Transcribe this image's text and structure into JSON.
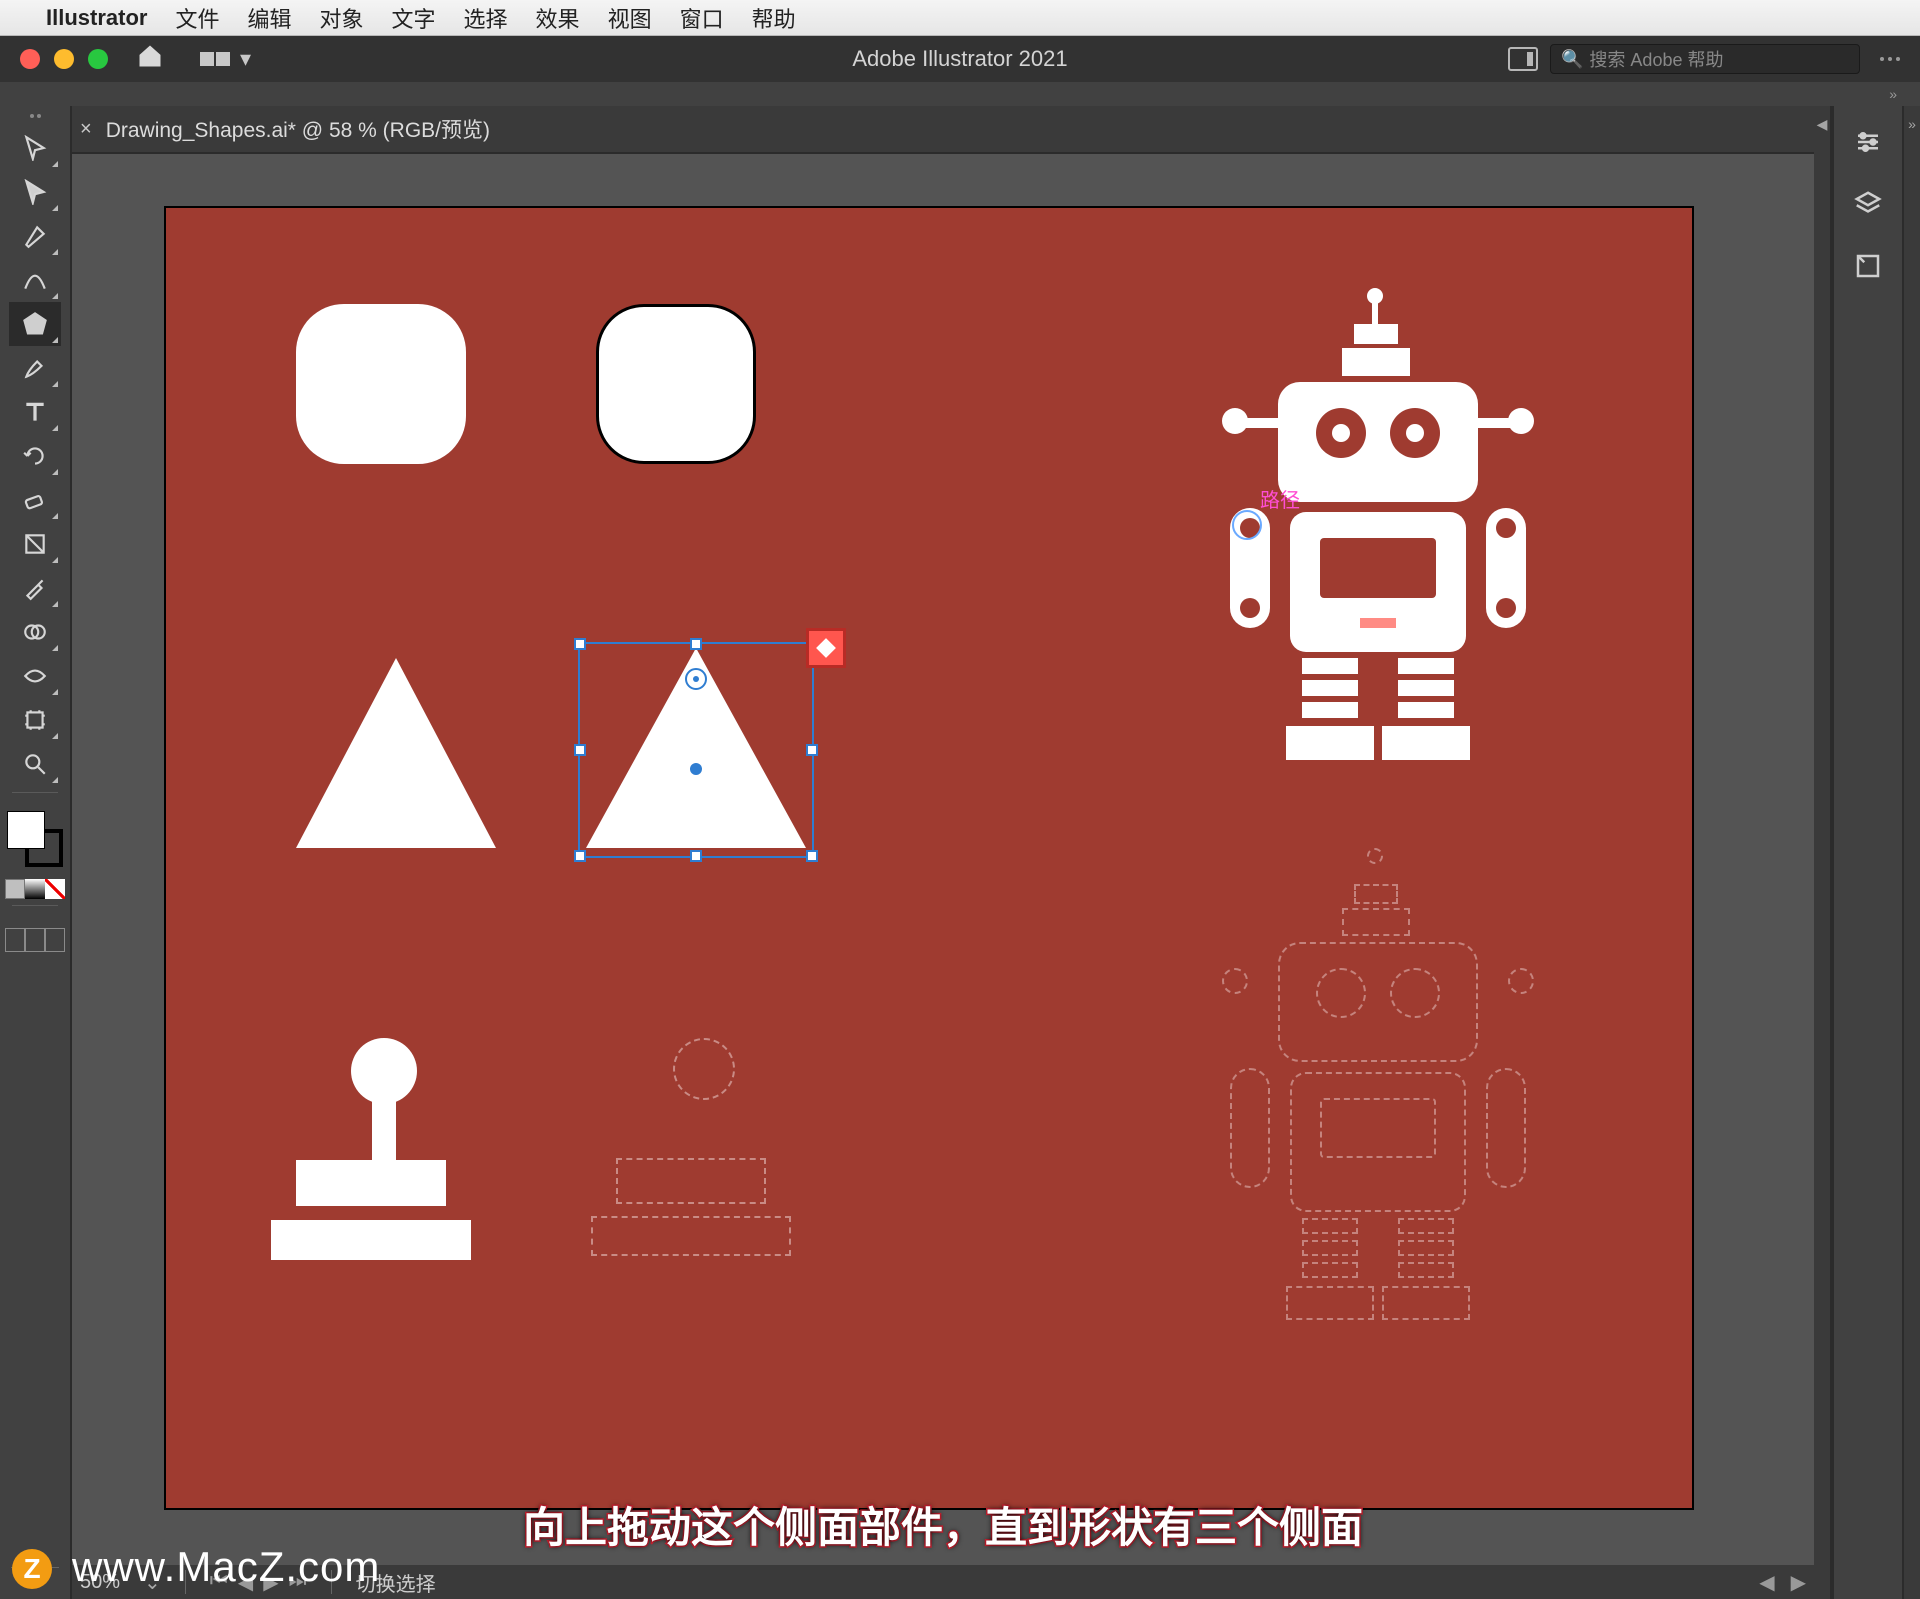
{
  "mac_menu": {
    "app": "Illustrator",
    "items": [
      "文件",
      "编辑",
      "对象",
      "文字",
      "选择",
      "效果",
      "视图",
      "窗口",
      "帮助"
    ]
  },
  "titlebar": {
    "app_title": "Adobe Illustrator 2021",
    "search_placeholder": "搜索 Adobe 帮助"
  },
  "document": {
    "tab_label": "Drawing_Shapes.ai* @ 58 % (RGB/预览)",
    "path_label": "路径"
  },
  "statusbar": {
    "zoom": "50%",
    "mode": "切换选择"
  },
  "right_panels": [
    "properties",
    "layers",
    "libraries"
  ],
  "tools": [
    "selection",
    "direct-selection",
    "pen",
    "curvature",
    "polygon",
    "brush",
    "type",
    "rotate",
    "eraser",
    "gradient",
    "shape-builder",
    "eyedropper",
    "warp",
    "free-transform",
    "artboard",
    "zoom"
  ],
  "caption": "向上拖动这个侧面部件，直到形状有三个侧面",
  "watermark": "www.MacZ.com",
  "colors": {
    "artboard": "#9f3b30",
    "selection": "#2f7dd1",
    "widget": "#ff564e"
  }
}
